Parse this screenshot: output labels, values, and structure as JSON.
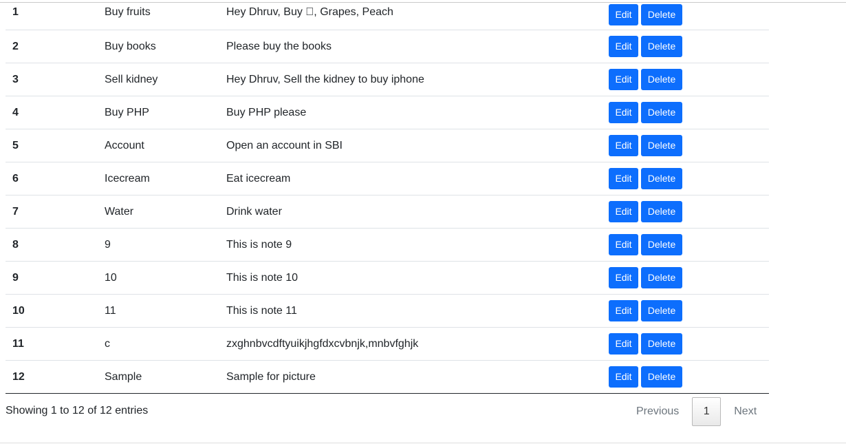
{
  "rows": [
    {
      "no": "1",
      "title": "Buy fruits",
      "desc": "Hey Dhruv, Buy , Grapes, Peach"
    },
    {
      "no": "2",
      "title": "Buy books",
      "desc": "Please buy the books"
    },
    {
      "no": "3",
      "title": "Sell kidney",
      "desc": "Hey Dhruv, Sell the kidney to buy iphone"
    },
    {
      "no": "4",
      "title": "Buy PHP",
      "desc": "Buy PHP please"
    },
    {
      "no": "5",
      "title": "Account",
      "desc": "Open an account in SBI"
    },
    {
      "no": "6",
      "title": "Icecream",
      "desc": "Eat icecream"
    },
    {
      "no": "7",
      "title": "Water",
      "desc": "Drink water"
    },
    {
      "no": "8",
      "title": "9",
      "desc": "This is note 9"
    },
    {
      "no": "9",
      "title": "10",
      "desc": "This is note 10"
    },
    {
      "no": "10",
      "title": "11",
      "desc": "This is note 11"
    },
    {
      "no": "11",
      "title": "c",
      "desc": "zxghnbvcdftyuikjhgfdxcvbnjk,mnbvfghjk"
    },
    {
      "no": "12",
      "title": "Sample",
      "desc": "Sample for picture"
    }
  ],
  "actions": {
    "edit_label": "Edit",
    "delete_label": "Delete"
  },
  "footer": {
    "info": "Showing 1 to 12 of 12 entries",
    "previous": "Previous",
    "current_page": "1",
    "next": "Next"
  },
  "colors": {
    "button": "#0d6efd"
  }
}
